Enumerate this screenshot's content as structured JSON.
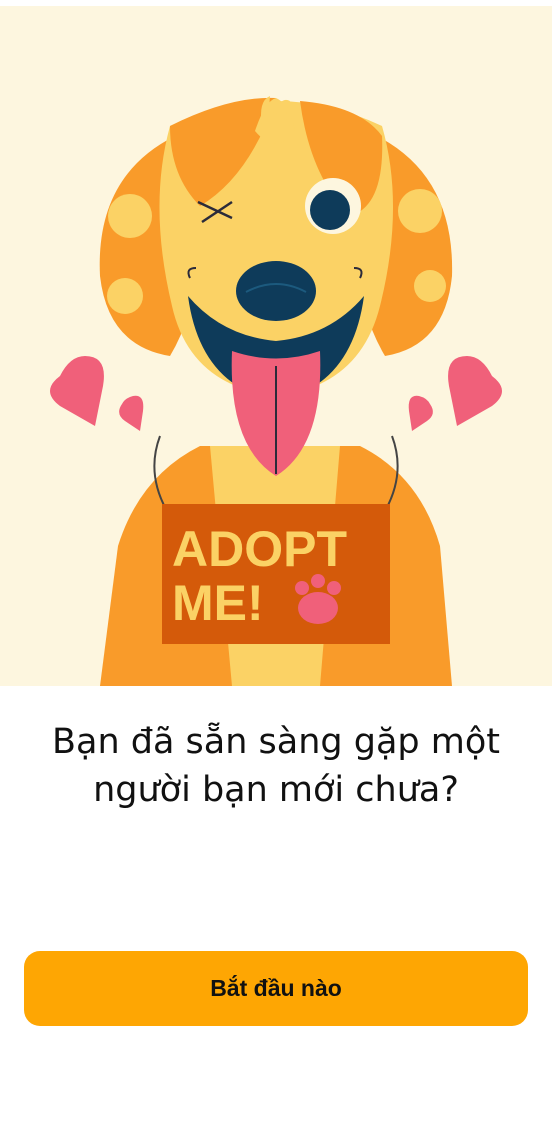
{
  "hero": {
    "sign_line1": "ADOPT",
    "sign_line2": "ME!"
  },
  "headline": {
    "line1": "Bạn đã sẵn sàng gặp một",
    "line2": "người bạn mới chưa?"
  },
  "start_button": {
    "label": "Bắt đầu nào"
  },
  "colors": {
    "hero_background": "#fdf6df",
    "button": "#fea603",
    "sign": "#d45a0a",
    "heart": "#f0607a"
  }
}
